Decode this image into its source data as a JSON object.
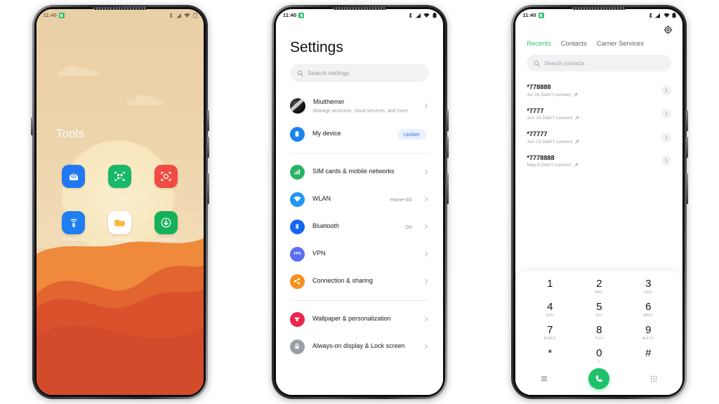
{
  "phones": {
    "home": {
      "status": {
        "time": "11:40",
        "icons": [
          "bluetooth-icon",
          "signal-icon",
          "wifi-icon",
          "battery-icon"
        ]
      },
      "folder_title": "Tools",
      "apps": [
        {
          "label": "Mi Drop",
          "icon": "mi-drop-icon",
          "faint": true
        },
        {
          "label": "Scanner",
          "icon": "qr-scanner-icon",
          "faint": true
        },
        {
          "label": "Screen Recorder",
          "icon": "screen-recorder-icon",
          "faint": true
        },
        {
          "label": "Mi Remote",
          "icon": "mi-remote-icon",
          "faint": false
        },
        {
          "label": "File Manager",
          "icon": "file-manager-icon",
          "faint": false
        },
        {
          "label": "Downloads",
          "icon": "downloads-icon",
          "faint": false
        }
      ]
    },
    "settings": {
      "status": {
        "time": "11:40"
      },
      "title": "Settings",
      "search_placeholder": "Search settings",
      "account": {
        "name": "Miuithemer",
        "subtitle": "Manage accounts, cloud services, and more"
      },
      "device": {
        "label": "My device",
        "badge": "Update",
        "icon": "phone-icon"
      },
      "items": [
        {
          "label": "SIM cards & mobile networks",
          "value": "",
          "icon": "signal-bars-icon",
          "color": "#28b463"
        },
        {
          "label": "WLAN",
          "value": "Home-5G",
          "icon": "wifi-icon",
          "color": "#2196f3"
        },
        {
          "label": "Bluetooth",
          "value": "On",
          "icon": "bluetooth-icon",
          "color": "#1565f0"
        },
        {
          "label": "VPN",
          "value": "",
          "icon": "vpn-icon",
          "color": "#5a6ff0"
        },
        {
          "label": "Connection & sharing",
          "value": "",
          "icon": "share-icon",
          "color": "#f4901e"
        }
      ],
      "items2": [
        {
          "label": "Wallpaper & personalization",
          "value": "",
          "icon": "brush-icon",
          "color": "#e8274b"
        },
        {
          "label": "Always-on display & Lock screen",
          "value": "",
          "icon": "lock-icon",
          "color": "#9aa0a6"
        }
      ]
    },
    "dialer": {
      "status": {
        "time": "11:40"
      },
      "settings_icon": "gear-icon",
      "tabs": [
        {
          "label": "Recents",
          "active": true
        },
        {
          "label": "Contacts",
          "active": false
        },
        {
          "label": "Carrier Services",
          "active": false
        }
      ],
      "search_placeholder": "Search contacts",
      "calls": [
        {
          "number": "*778888",
          "detail": "Jul 26 Didn't connect"
        },
        {
          "number": "*7777",
          "detail": "Jun 19 Didn't connect"
        },
        {
          "number": "*77777",
          "detail": "Jun 13 Didn't connect"
        },
        {
          "number": "*7778888",
          "detail": "May 8 Didn't connect"
        }
      ],
      "keys": [
        {
          "digit": "1",
          "sub": ""
        },
        {
          "digit": "2",
          "sub": "ABC"
        },
        {
          "digit": "3",
          "sub": "DEF"
        },
        {
          "digit": "4",
          "sub": "GHI"
        },
        {
          "digit": "5",
          "sub": "JKL"
        },
        {
          "digit": "6",
          "sub": "MNO"
        },
        {
          "digit": "7",
          "sub": "PQRS"
        },
        {
          "digit": "8",
          "sub": "TUV"
        },
        {
          "digit": "9",
          "sub": "WXYZ"
        },
        {
          "digit": "*",
          "sub": ""
        },
        {
          "digit": "0",
          "sub": "+"
        },
        {
          "digit": "#",
          "sub": ""
        }
      ],
      "actions": {
        "menu": "menu-icon",
        "call": "call-icon",
        "keypad": "keypad-icon"
      },
      "accent": "#1fc268"
    }
  }
}
